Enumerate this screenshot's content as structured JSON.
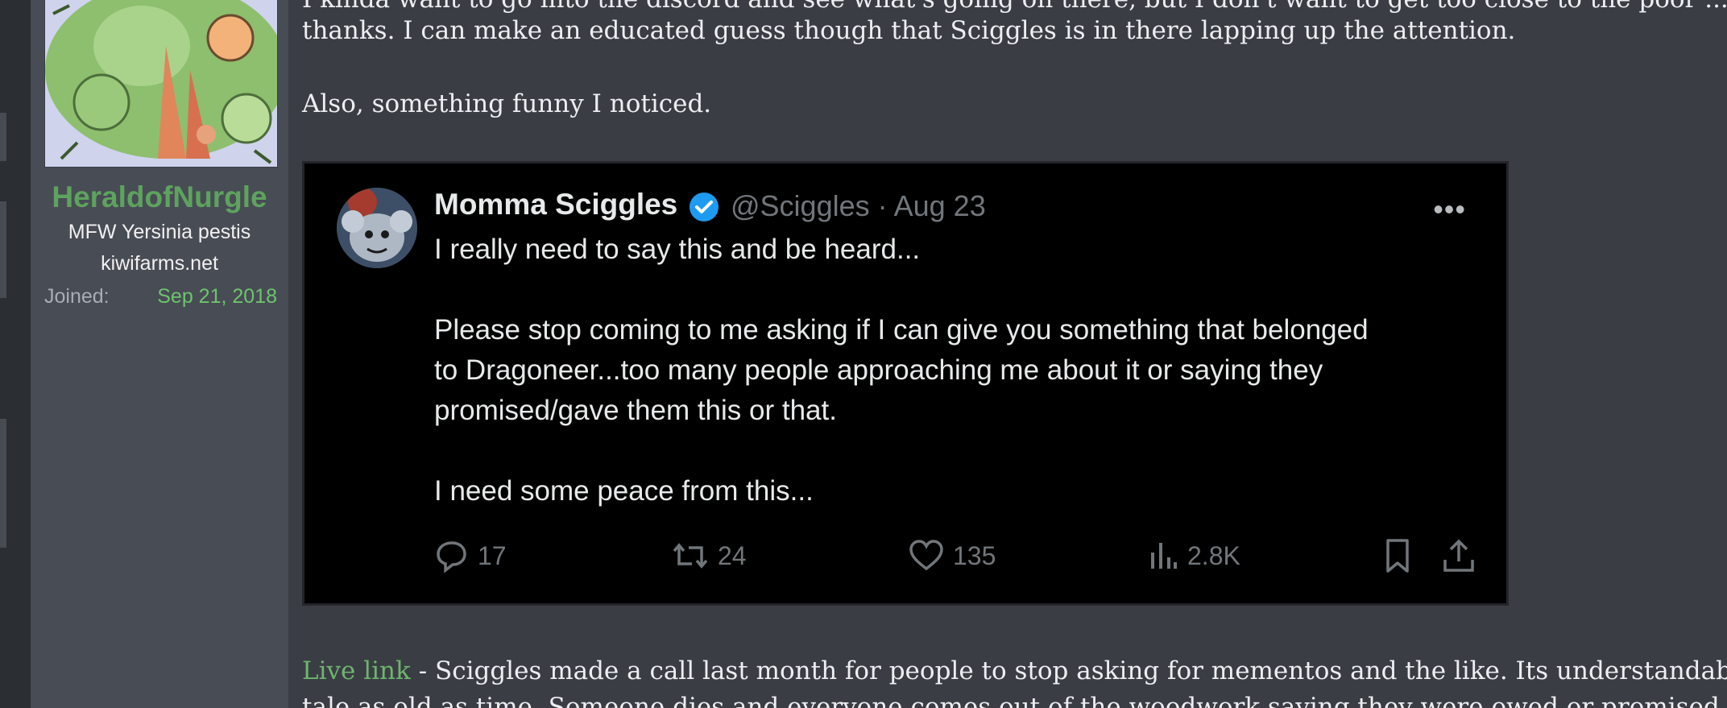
{
  "user": {
    "name": "HeraldofNurgle",
    "title": "MFW Yersinia pestis",
    "site": "kiwifarms.net",
    "joined_label": "Joined:",
    "joined_date": "Sep 21, 2018"
  },
  "post": {
    "line_top_partial": "I kinda want to go into the discord and see what's going on there, but I don't want to get too close to the poor ...",
    "line_1": "thanks. I can make an educated guess though that Sciggles is in there lapping up the attention.",
    "line_2": "Also, something funny I noticed.",
    "live_link": "Live link",
    "after_link": " - Sciggles made a call last month for people to stop asking for mementos and the like. Its understandable, it's a",
    "line_bottom_partial": "tale as old as time. Someone dies and everyone comes out of the woodwork saying they were owed or promised that"
  },
  "tweet": {
    "name": "Momma Sciggles",
    "handle_date": "@Sciggles · Aug 23",
    "more": "•••",
    "lines": [
      "I really need to say this and be heard...",
      "Please stop coming to me asking if I can give you something that belonged",
      "to Dragoneer...too many people approaching me about it or saying they",
      "promised/gave them this or that.",
      "I need some peace from this..."
    ],
    "replies": "17",
    "reposts": "24",
    "likes": "135",
    "views": "2.8K",
    "verified_color": "#1d9bf0",
    "icons": [
      "reply-icon",
      "repost-icon",
      "like-icon",
      "views-icon",
      "bookmark-icon",
      "share-icon"
    ]
  },
  "colors": {
    "username": "#5da35d",
    "joined_date": "#6dc46d",
    "link": "#6fb36f",
    "background": "#3a3d44",
    "sidebar": "#484c55"
  }
}
